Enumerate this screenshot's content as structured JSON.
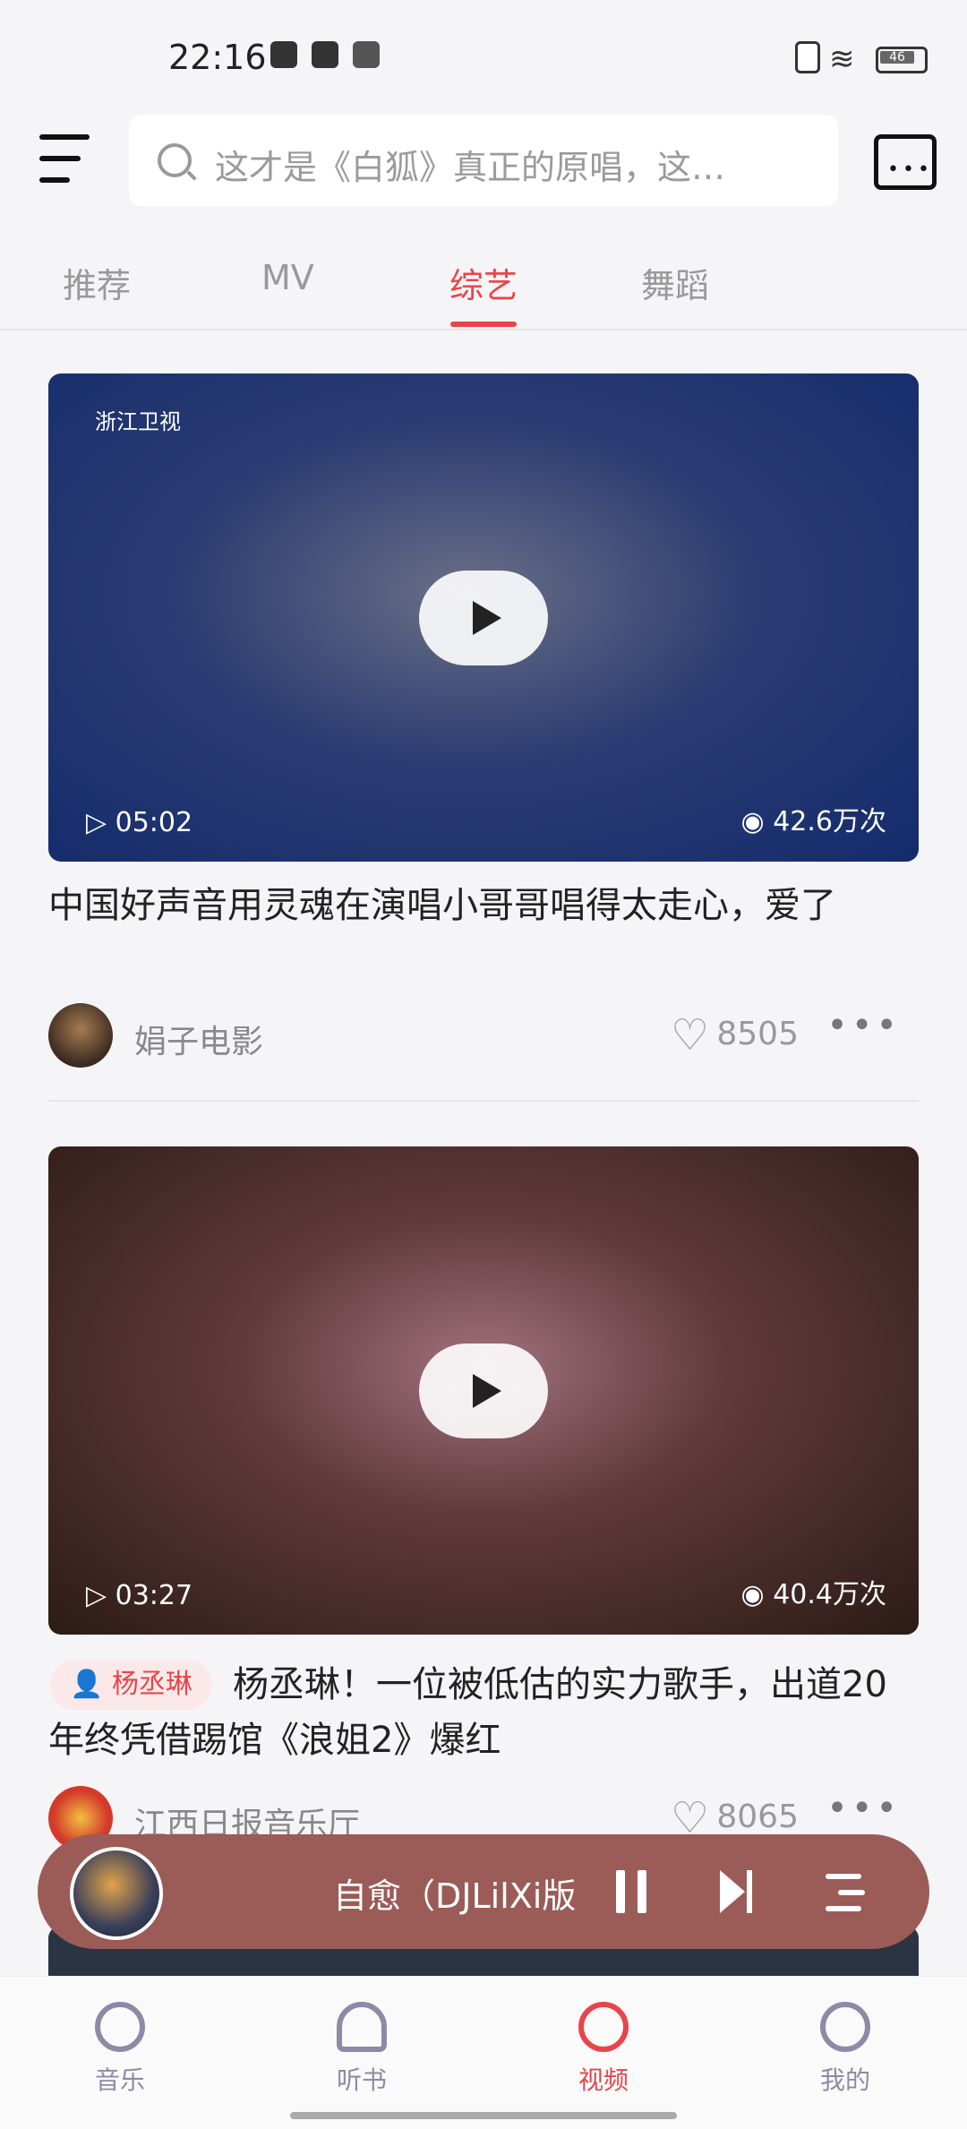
{
  "status_bar": {
    "time": "22:16",
    "battery": "46"
  },
  "search": {
    "placeholder": "这才是《白狐》真正的原唱，这…"
  },
  "tabs": [
    {
      "label": "推荐"
    },
    {
      "label": "MV"
    },
    {
      "label": "综艺",
      "active": true
    },
    {
      "label": "舞蹈"
    }
  ],
  "videos": [
    {
      "duration": "05:02",
      "views": "42.6万次",
      "title": "中国好声音用灵魂在演唱小哥哥唱得太走心，爱了",
      "channel_logo": "浙江卫视",
      "author": "娟子电影",
      "likes": "8505"
    },
    {
      "duration": "03:27",
      "views": "40.4万次",
      "tag": "杨丞琳",
      "title": "杨丞琳！一位被低估的实力歌手，出道20年终凭借踢馆《浪姐2》爆红",
      "author": "江西日报音乐厅",
      "likes": "8065"
    }
  ],
  "player": {
    "title": "自愈（DJLilXi版"
  },
  "bottom_nav": [
    {
      "label": "音乐",
      "icon": "music-disc-icon"
    },
    {
      "label": "听书",
      "icon": "headphones-icon"
    },
    {
      "label": "视频",
      "icon": "video-play-icon",
      "active": true
    },
    {
      "label": "我的",
      "icon": "profile-smile-icon"
    }
  ],
  "colors": {
    "accent": "#e8454a",
    "player_bg": "#9b5b57",
    "nav_inactive": "#8d8aa8"
  }
}
